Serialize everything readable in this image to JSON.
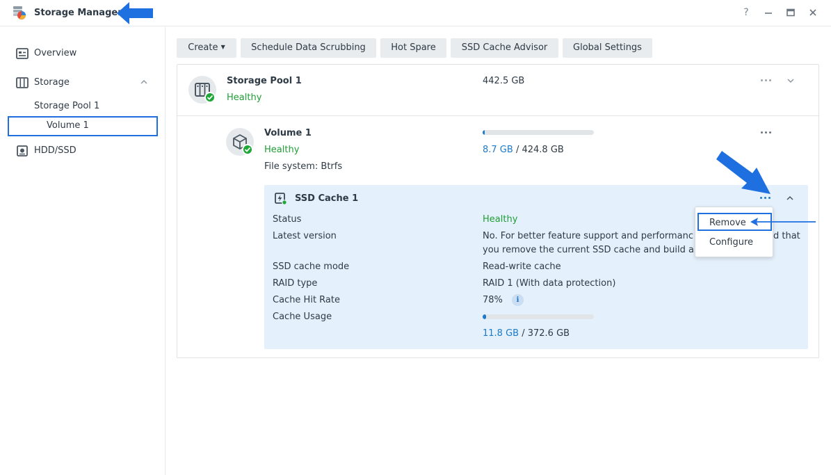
{
  "window": {
    "title": "Storage Manager",
    "controls": {
      "help": "?",
      "minimize": "—",
      "maximize": "▣",
      "close": "✕"
    }
  },
  "sidebar": {
    "overview": "Overview",
    "storage": "Storage",
    "storage_pool": "Storage Pool 1",
    "volume": "Volume 1",
    "hdd": "HDD/SSD"
  },
  "toolbar": {
    "create": "Create",
    "scrub": "Schedule Data Scrubbing",
    "hot_spare": "Hot Spare",
    "ssd_advisor": "SSD Cache Advisor",
    "global_settings": "Global Settings"
  },
  "pool": {
    "name": "Storage Pool 1",
    "status": "Healthy",
    "size": "442.5 GB"
  },
  "volume": {
    "name": "Volume 1",
    "status": "Healthy",
    "filesystem": "File system: Btrfs",
    "used": "8.7 GB",
    "separator": " / ",
    "total": "424.8 GB",
    "usage_fraction": 0.02
  },
  "cache": {
    "name": "SSD Cache 1",
    "rows": {
      "status_label": "Status",
      "status_value": "Healthy",
      "version_label": "Latest version",
      "version_line1": "No. For better feature support and performanc",
      "version_line1_tail": "d that",
      "version_line2": "you remove the current SSD cache and build a",
      "mode_label": "SSD cache mode",
      "mode_value": "Read-write cache",
      "raid_label": "RAID type",
      "raid_value": "RAID 1 (With data protection)",
      "hit_label": "Cache Hit Rate",
      "hit_value": "78%",
      "usage_label": "Cache Usage",
      "usage_used": "11.8 GB",
      "usage_separator": " / ",
      "usage_total": "372.6 GB",
      "usage_fraction": 0.03
    }
  },
  "context_menu": {
    "remove": "Remove",
    "configure": "Configure"
  },
  "colors": {
    "healthy": "#1f9e36",
    "accent": "#1b7ac9",
    "annotation": "#1e6fe0"
  }
}
